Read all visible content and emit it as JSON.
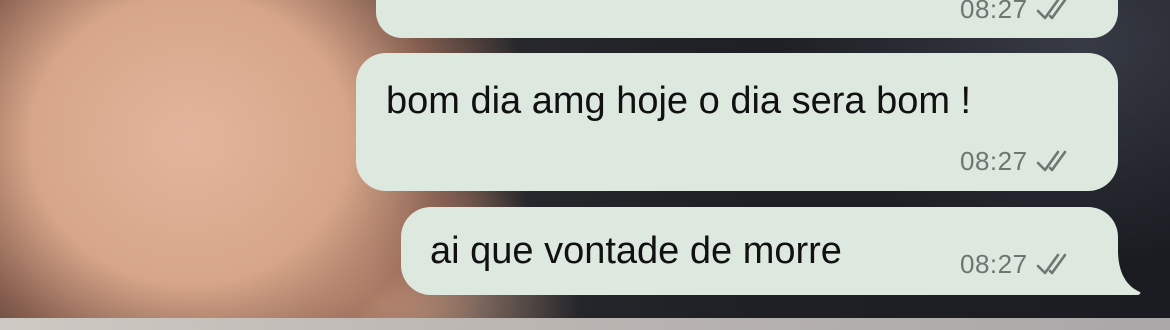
{
  "conversation": {
    "messages": [
      {
        "text": "",
        "time": "08:27",
        "status": "double-check-icon"
      },
      {
        "text": "bom dia amg hoje o dia sera bom !",
        "time": "08:27",
        "status": "double-check-icon"
      },
      {
        "text": "ai que vontade de morre",
        "time": "08:27",
        "status": "double-check-icon"
      }
    ]
  },
  "colors": {
    "bubble_background": "#dde8df",
    "text": "#111111",
    "meta_text": "#6f7570"
  }
}
